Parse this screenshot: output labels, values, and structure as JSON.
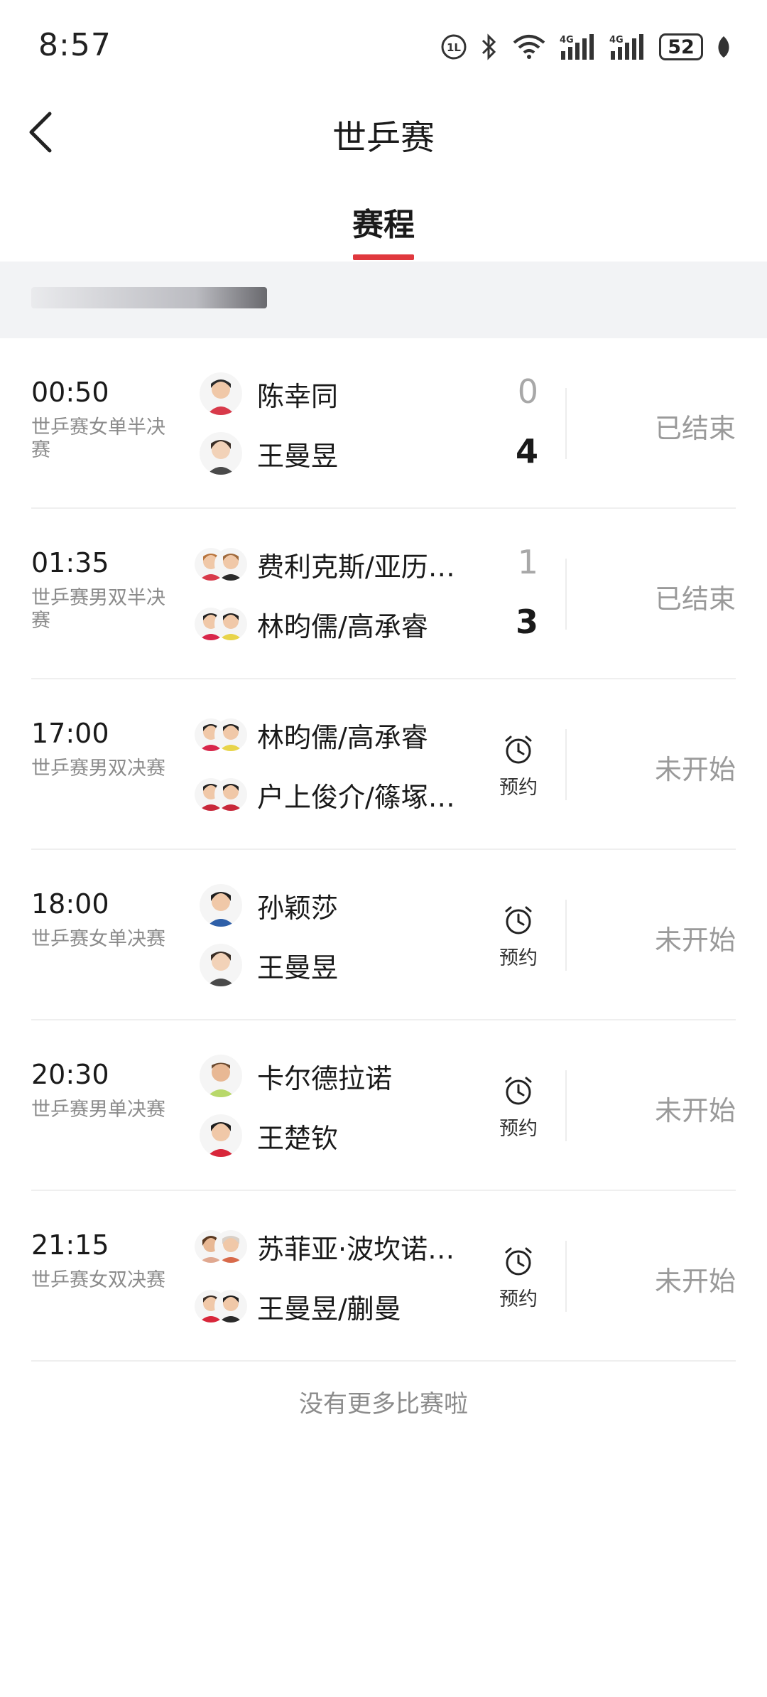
{
  "status_bar": {
    "time": "8:57",
    "battery": "52"
  },
  "header": {
    "title": "世乒赛"
  },
  "tabs": [
    {
      "label": "赛程",
      "active": true
    }
  ],
  "colors": {
    "accent": "#e0383e",
    "muted": "#9a9a9a"
  },
  "matches": [
    {
      "time": "00:50",
      "name": "世乒赛女单半决赛",
      "team1": "陈幸同",
      "team2": "王曼昱",
      "score1": "0",
      "score2": "4",
      "winner": 2,
      "status": "已结束"
    },
    {
      "time": "01:35",
      "name": "世乒赛男双半决赛",
      "team1": "费利克斯/亚历…",
      "team2": "林昀儒/高承睿",
      "score1": "1",
      "score2": "3",
      "winner": 2,
      "status": "已结束"
    },
    {
      "time": "17:00",
      "name": "世乒赛男双决赛",
      "team1": "林昀儒/高承睿",
      "team2": "户上俊介/篠塚…",
      "reserve": "预约",
      "status": "未开始"
    },
    {
      "time": "18:00",
      "name": "世乒赛女单决赛",
      "team1": "孙颖莎",
      "team2": "王曼昱",
      "reserve": "预约",
      "status": "未开始"
    },
    {
      "time": "20:30",
      "name": "世乒赛男单决赛",
      "team1": "卡尔德拉诺",
      "team2": "王楚钦",
      "reserve": "预约",
      "status": "未开始"
    },
    {
      "time": "21:15",
      "name": "世乒赛女双决赛",
      "team1": "苏菲亚·波坎诺…",
      "team2": "王曼昱/蒯曼",
      "reserve": "预约",
      "status": "未开始"
    }
  ],
  "footer": {
    "no_more": "没有更多比赛啦"
  }
}
